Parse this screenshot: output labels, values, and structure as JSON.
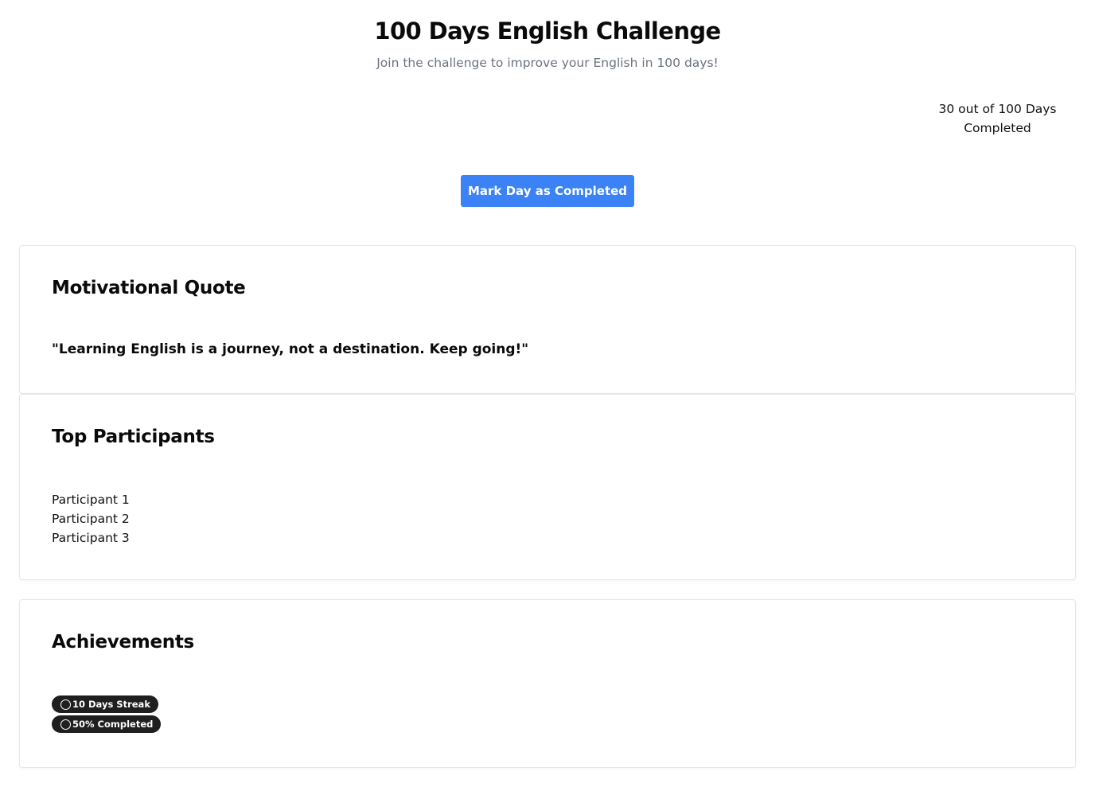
{
  "header": {
    "title": "100 Days English Challenge",
    "subtitle": "Join the challenge to improve your English in 100 days!"
  },
  "progress": {
    "text": "30 out of 100 Days Completed",
    "completed_days": 30,
    "total_days": 100
  },
  "actions": {
    "complete_label": "Mark Day as Completed"
  },
  "quote_section": {
    "title": "Motivational Quote",
    "quote": "\"Learning English is a journey, not a destination. Keep going!\""
  },
  "participants_section": {
    "title": "Top Participants",
    "items": [
      "Participant 1",
      "Participant 2",
      "Participant 3"
    ]
  },
  "achievements_section": {
    "title": "Achievements",
    "badges": [
      {
        "label": "10 Days Streak",
        "icon": "circle-icon"
      },
      {
        "label": "50% Completed",
        "icon": "circle-icon"
      }
    ]
  },
  "colors": {
    "accent": "#3b82f6",
    "badge_background": "#1f1f1f",
    "subtitle": "#6b7280",
    "card_border": "#e5e7eb"
  }
}
